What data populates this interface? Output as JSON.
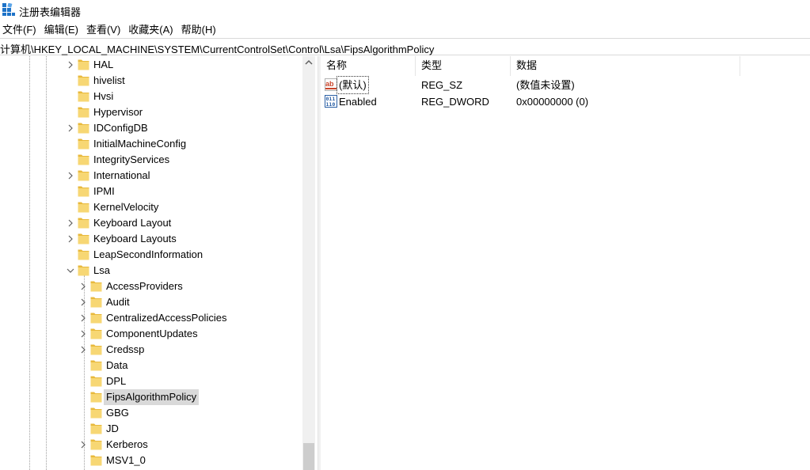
{
  "window": {
    "title": "注册表编辑器"
  },
  "menu": [
    "文件(F)",
    "编辑(E)",
    "查看(V)",
    "收藏夹(A)",
    "帮助(H)"
  ],
  "address": "计算机\\HKEY_LOCAL_MACHINE\\SYSTEM\\CurrentControlSet\\Control\\Lsa\\FipsAlgorithmPolicy",
  "tree": {
    "items": [
      {
        "label": "HAL",
        "level": 1,
        "expander": "collapsed"
      },
      {
        "label": "hivelist",
        "level": 1,
        "expander": "none"
      },
      {
        "label": "Hvsi",
        "level": 1,
        "expander": "none"
      },
      {
        "label": "Hypervisor",
        "level": 1,
        "expander": "none"
      },
      {
        "label": "IDConfigDB",
        "level": 1,
        "expander": "collapsed"
      },
      {
        "label": "InitialMachineConfig",
        "level": 1,
        "expander": "none"
      },
      {
        "label": "IntegrityServices",
        "level": 1,
        "expander": "none"
      },
      {
        "label": "International",
        "level": 1,
        "expander": "collapsed"
      },
      {
        "label": "IPMI",
        "level": 1,
        "expander": "none"
      },
      {
        "label": "KernelVelocity",
        "level": 1,
        "expander": "none"
      },
      {
        "label": "Keyboard Layout",
        "level": 1,
        "expander": "collapsed"
      },
      {
        "label": "Keyboard Layouts",
        "level": 1,
        "expander": "collapsed"
      },
      {
        "label": "LeapSecondInformation",
        "level": 1,
        "expander": "none"
      },
      {
        "label": "Lsa",
        "level": 1,
        "expander": "expanded"
      },
      {
        "label": "AccessProviders",
        "level": 2,
        "expander": "collapsed"
      },
      {
        "label": "Audit",
        "level": 2,
        "expander": "collapsed"
      },
      {
        "label": "CentralizedAccessPolicies",
        "level": 2,
        "expander": "collapsed"
      },
      {
        "label": "ComponentUpdates",
        "level": 2,
        "expander": "collapsed"
      },
      {
        "label": "Credssp",
        "level": 2,
        "expander": "collapsed"
      },
      {
        "label": "Data",
        "level": 2,
        "expander": "none"
      },
      {
        "label": "DPL",
        "level": 2,
        "expander": "none"
      },
      {
        "label": "FipsAlgorithmPolicy",
        "level": 2,
        "expander": "none",
        "selected": true
      },
      {
        "label": "GBG",
        "level": 2,
        "expander": "none"
      },
      {
        "label": "JD",
        "level": 2,
        "expander": "none"
      },
      {
        "label": "Kerberos",
        "level": 2,
        "expander": "collapsed"
      },
      {
        "label": "MSV1_0",
        "level": 2,
        "expander": "none"
      }
    ]
  },
  "list": {
    "columns": [
      "名称",
      "类型",
      "数据"
    ],
    "rows": [
      {
        "name": "(默认)",
        "type": "REG_SZ",
        "data": "(数值未设置)",
        "icon": "string-value-icon"
      },
      {
        "name": "Enabled",
        "type": "REG_DWORD",
        "data": "0x00000000 (0)",
        "icon": "binary-value-icon"
      }
    ]
  },
  "colors": {
    "folder": "#f7d774",
    "folder_dark": "#e8b93c",
    "selection": "#d9d9d9",
    "string_icon": "#c8442a",
    "binary_icon": "#2a5fa5"
  }
}
